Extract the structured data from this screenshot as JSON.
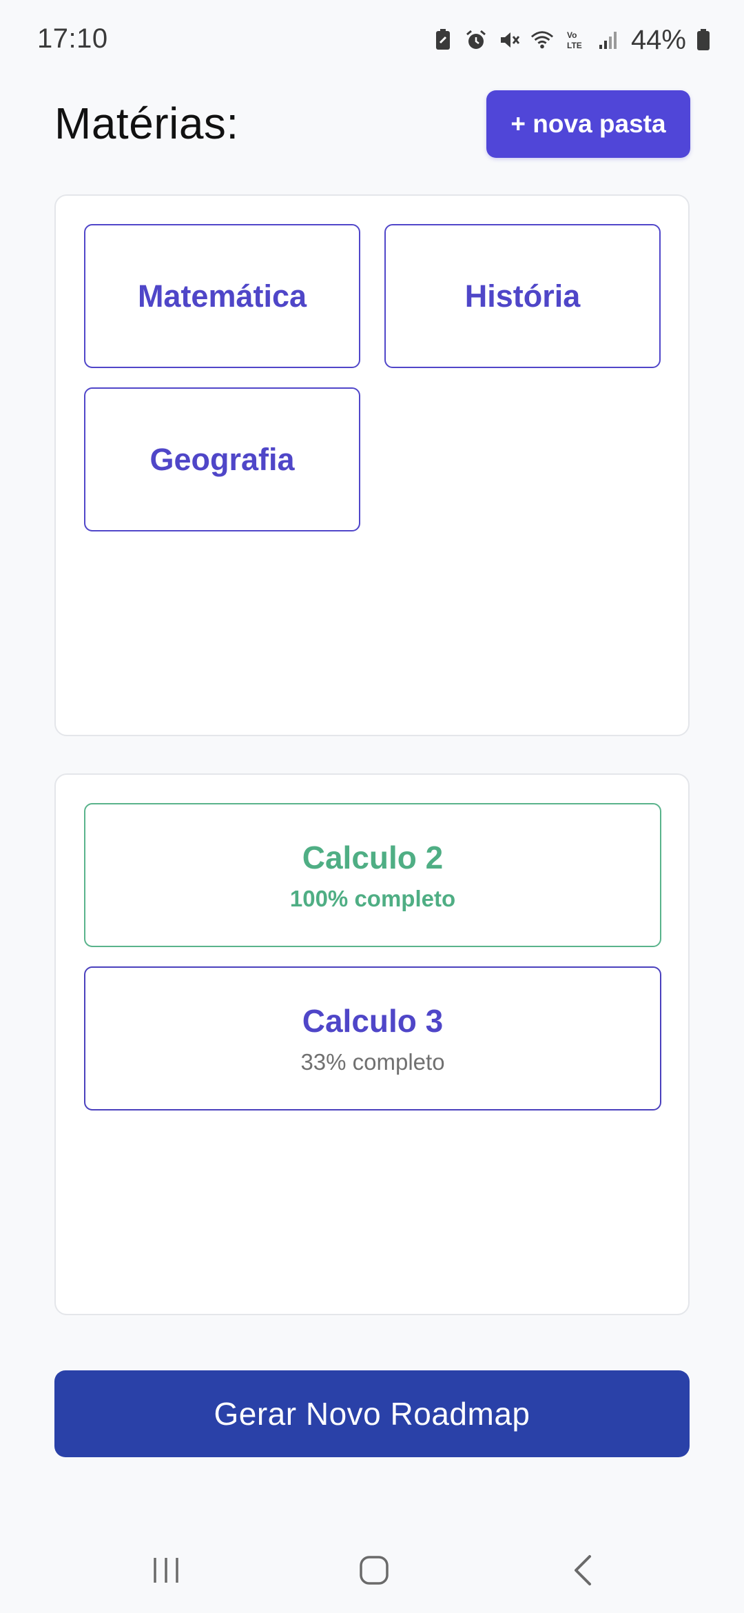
{
  "status_bar": {
    "time": "17:10",
    "battery_percent": "44%",
    "icons": [
      "battery-saver-icon",
      "alarm-icon",
      "mute-icon",
      "wifi-icon",
      "volte-icon",
      "signal-icon",
      "battery-icon"
    ]
  },
  "header": {
    "title": "Matérias:",
    "new_folder_label": "+ nova pasta"
  },
  "subjects": [
    {
      "label": "Matemática"
    },
    {
      "label": "História"
    },
    {
      "label": "Geografia"
    }
  ],
  "roadmaps": [
    {
      "title": "Calculo 2",
      "status": "100% completo",
      "progress": 1.0
    },
    {
      "title": "Calculo 3",
      "status": "33% completo",
      "progress": 0.33
    }
  ],
  "actions": {
    "generate_label": "Gerar Novo Roadmap"
  },
  "colors": {
    "accent": "#5046d8",
    "primary_button": "#2a41a8",
    "complete": "#4fae84",
    "background": "#f8f9fb"
  },
  "nav_bar": {
    "icons": [
      "recent-apps-icon",
      "home-icon",
      "back-icon"
    ]
  }
}
